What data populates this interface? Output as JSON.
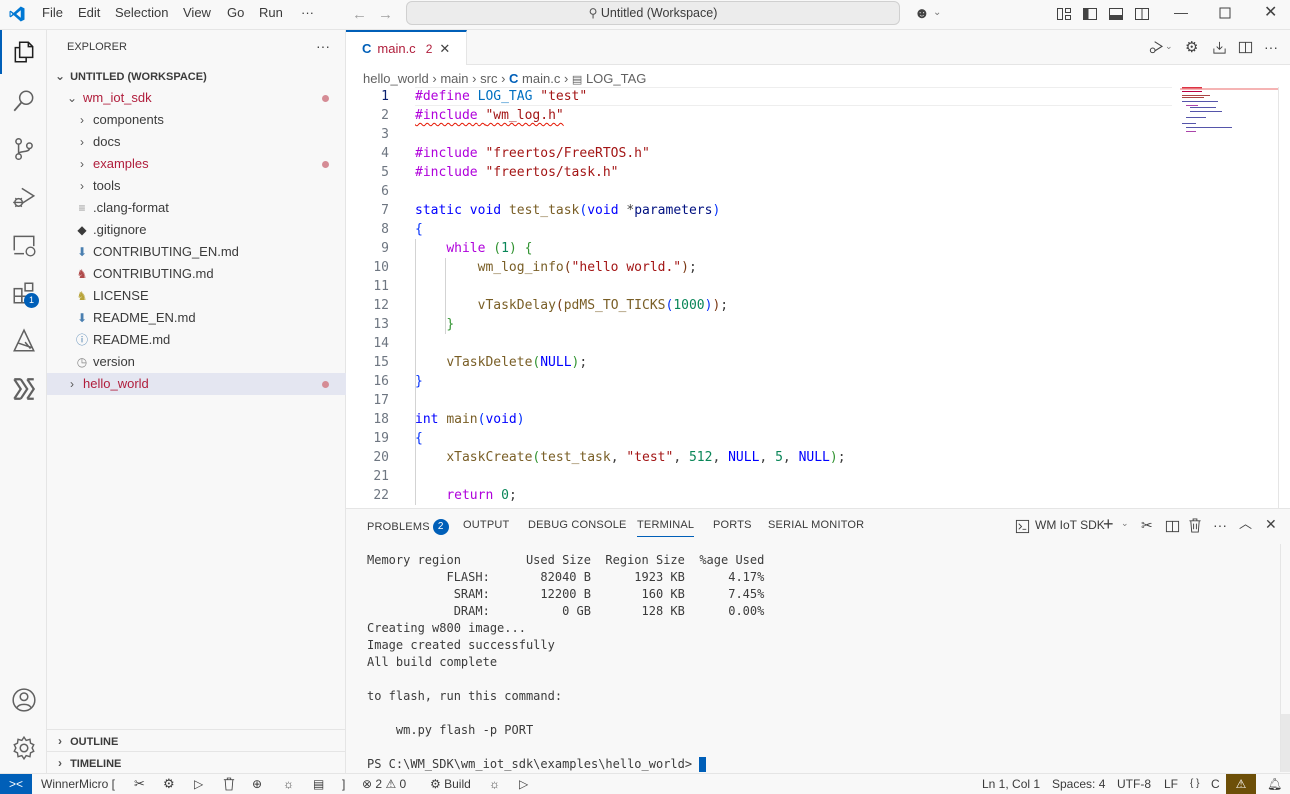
{
  "titlebar": {
    "menu": [
      "File",
      "Edit",
      "Selection",
      "View",
      "Go",
      "Run",
      "···"
    ],
    "command_center": "Untitled (Workspace)",
    "icons": [
      "vscode-logo-icon",
      "back-arrow-icon",
      "forward-arrow-icon",
      "search-icon",
      "copilot-icon",
      "customize-layout-icon",
      "toggle-primary-sidebar-icon",
      "toggle-panel-icon",
      "toggle-secondary-sidebar-icon",
      "minimize-icon",
      "maximize-icon",
      "close-icon"
    ]
  },
  "activitybar": {
    "items": [
      {
        "name": "explorer",
        "icon": "files-icon",
        "active": true
      },
      {
        "name": "search",
        "icon": "search-icon"
      },
      {
        "name": "source-control",
        "icon": "source-control-icon"
      },
      {
        "name": "run-debug",
        "icon": "run-debug-icon"
      },
      {
        "name": "remote-explorer",
        "icon": "remote-explorer-icon"
      },
      {
        "name": "extensions",
        "icon": "extensions-icon",
        "badge": "1"
      },
      {
        "name": "cmake",
        "icon": "cmake-icon"
      },
      {
        "name": "winnermicro",
        "icon": "winnermicro-icon"
      }
    ],
    "bottom": [
      {
        "name": "accounts",
        "icon": "account-icon"
      },
      {
        "name": "manage",
        "icon": "gear-icon"
      }
    ]
  },
  "sidebar": {
    "title": "EXPLORER",
    "more": "···",
    "workspace": "UNTITLED (WORKSPACE)",
    "tree": [
      {
        "label": "wm_iot_sdk",
        "type": "folder-open",
        "depth": 1,
        "modified": true
      },
      {
        "label": "components",
        "type": "folder",
        "depth": 2
      },
      {
        "label": "docs",
        "type": "folder",
        "depth": 2
      },
      {
        "label": "examples",
        "type": "folder",
        "depth": 2,
        "modified": true
      },
      {
        "label": "tools",
        "type": "folder",
        "depth": 2
      },
      {
        "label": ".clang-format",
        "type": "file",
        "icon": "≡",
        "depth": 2
      },
      {
        "label": ".gitignore",
        "type": "file",
        "icon": "◆",
        "depth": 2
      },
      {
        "label": "CONTRIBUTING_EN.md",
        "type": "file",
        "icon": "⬇",
        "depth": 2
      },
      {
        "label": "CONTRIBUTING.md",
        "type": "file",
        "icon": "♞",
        "depth": 2
      },
      {
        "label": "LICENSE",
        "type": "file",
        "icon": "♞",
        "depth": 2
      },
      {
        "label": "README_EN.md",
        "type": "file",
        "icon": "⬇",
        "depth": 2
      },
      {
        "label": "README.md",
        "type": "file",
        "icon": "ⓘ",
        "depth": 2
      },
      {
        "label": "version",
        "type": "file",
        "icon": "◷",
        "depth": 2
      },
      {
        "label": "hello_world",
        "type": "folder",
        "depth": 1,
        "modified": true,
        "selected": true
      }
    ],
    "sections": [
      "OUTLINE",
      "TIMELINE"
    ]
  },
  "editor": {
    "tab": {
      "icon": "C",
      "label": "main.c",
      "problems": "2"
    },
    "breadcrumb": [
      "hello_world",
      "main",
      "src",
      "main.c",
      "LOG_TAG"
    ],
    "actions": [
      "run-debug-icon",
      "settings-icon",
      "download-icon",
      "split-editor-icon",
      "more-icon"
    ],
    "lines": [
      {
        "n": "1",
        "html": "<span class='k'>#define</span> <span class='m'>LOG_TAG</span> <span class='s'>\"test\"</span>"
      },
      {
        "n": "2",
        "html": "<span class='squig'><span class='k'>#include</span> <span class='s'>\"wm_log.h\"</span></span>"
      },
      {
        "n": "3",
        "html": ""
      },
      {
        "n": "4",
        "html": "<span class='k'>#include</span> <span class='s'>\"freertos/FreeRTOS.h\"</span>"
      },
      {
        "n": "5",
        "html": "<span class='k'>#include</span> <span class='s'>\"freertos/task.h\"</span>"
      },
      {
        "n": "6",
        "html": ""
      },
      {
        "n": "7",
        "html": "<span class='t'>static</span> <span class='t'>void</span> <span class='f'>test_task</span><span class='b1'>(</span><span class='t'>void</span> *<span class='v'>parameters</span><span class='b1'>)</span>"
      },
      {
        "n": "8",
        "html": "<span class='b1'>{</span>"
      },
      {
        "n": "9",
        "html": "    <span class='k'>while</span> <span class='b2'>(</span><span class='n'>1</span><span class='b2'>)</span> <span class='b2'>{</span>"
      },
      {
        "n": "10",
        "html": "        <span class='f'>wm_log_info</span><span class='b3'>(</span><span class='s'>\"hello world.\"</span><span class='b3'>)</span>;"
      },
      {
        "n": "11",
        "html": ""
      },
      {
        "n": "12",
        "html": "        <span class='f'>vTaskDelay</span><span class='b3'>(</span><span class='f'>pdMS_TO_TICKS</span><span class='b1'>(</span><span class='n'>1000</span><span class='b1'>)</span><span class='b3'>)</span>;"
      },
      {
        "n": "13",
        "html": "    <span class='b2'>}</span>"
      },
      {
        "n": "14",
        "html": ""
      },
      {
        "n": "15",
        "html": "    <span class='f'>vTaskDelete</span><span class='b2'>(</span><span class='t'>NULL</span><span class='b2'>)</span>;"
      },
      {
        "n": "16",
        "html": "<span class='b1'>}</span>"
      },
      {
        "n": "17",
        "html": ""
      },
      {
        "n": "18",
        "html": "<span class='t'>int</span> <span class='f'>main</span><span class='b1'>(</span><span class='t'>void</span><span class='b1'>)</span>"
      },
      {
        "n": "19",
        "html": "<span class='b1'>{</span>"
      },
      {
        "n": "20",
        "html": "    <span class='f'>xTaskCreate</span><span class='b2'>(</span><span class='f'>test_task</span>, <span class='s'>\"test\"</span>, <span class='n'>512</span>, <span class='t'>NULL</span>, <span class='n'>5</span>, <span class='t'>NULL</span><span class='b2'>)</span>;"
      },
      {
        "n": "21",
        "html": ""
      },
      {
        "n": "22",
        "html": "    <span class='k'>return</span> <span class='n'>0</span>;"
      }
    ]
  },
  "panel": {
    "tabs": [
      {
        "label": "PROBLEMS",
        "badge": "2"
      },
      {
        "label": "OUTPUT"
      },
      {
        "label": "DEBUG CONSOLE"
      },
      {
        "label": "TERMINAL",
        "active": true
      },
      {
        "label": "PORTS"
      },
      {
        "label": "SERIAL MONITOR"
      }
    ],
    "terminal_name": "WM IoT SDK",
    "actions": [
      "new-terminal-icon",
      "chevron-down-icon",
      "tools-icon",
      "split-terminal-icon",
      "trash-icon",
      "more-icon",
      "maximize-panel-icon",
      "close-panel-icon"
    ],
    "terminal_lines": [
      "Memory region         Used Size  Region Size  %age Used",
      "           FLASH:       82040 B      1923 KB      4.17%",
      "            SRAM:       12200 B       160 KB      7.45%",
      "            DRAM:          0 GB       128 KB      0.00%",
      "Creating w800 image...",
      "Image created successfully",
      "All build complete",
      "",
      "to flash, run this command:",
      "",
      "    wm.py flash -p PORT",
      ""
    ],
    "prompt": "PS C:\\WM_SDK\\wm_iot_sdk\\examples\\hello_world> "
  },
  "statusbar": {
    "remote_icon": "><",
    "project": "WinnerMicro [",
    "project_end": "]",
    "errors": "2",
    "warnings": "0",
    "build": "Build",
    "position": "Ln 1, Col 1",
    "spaces": "Spaces: 4",
    "encoding": "UTF-8",
    "eol": "LF",
    "language": "C",
    "language_icon": "{ }"
  }
}
